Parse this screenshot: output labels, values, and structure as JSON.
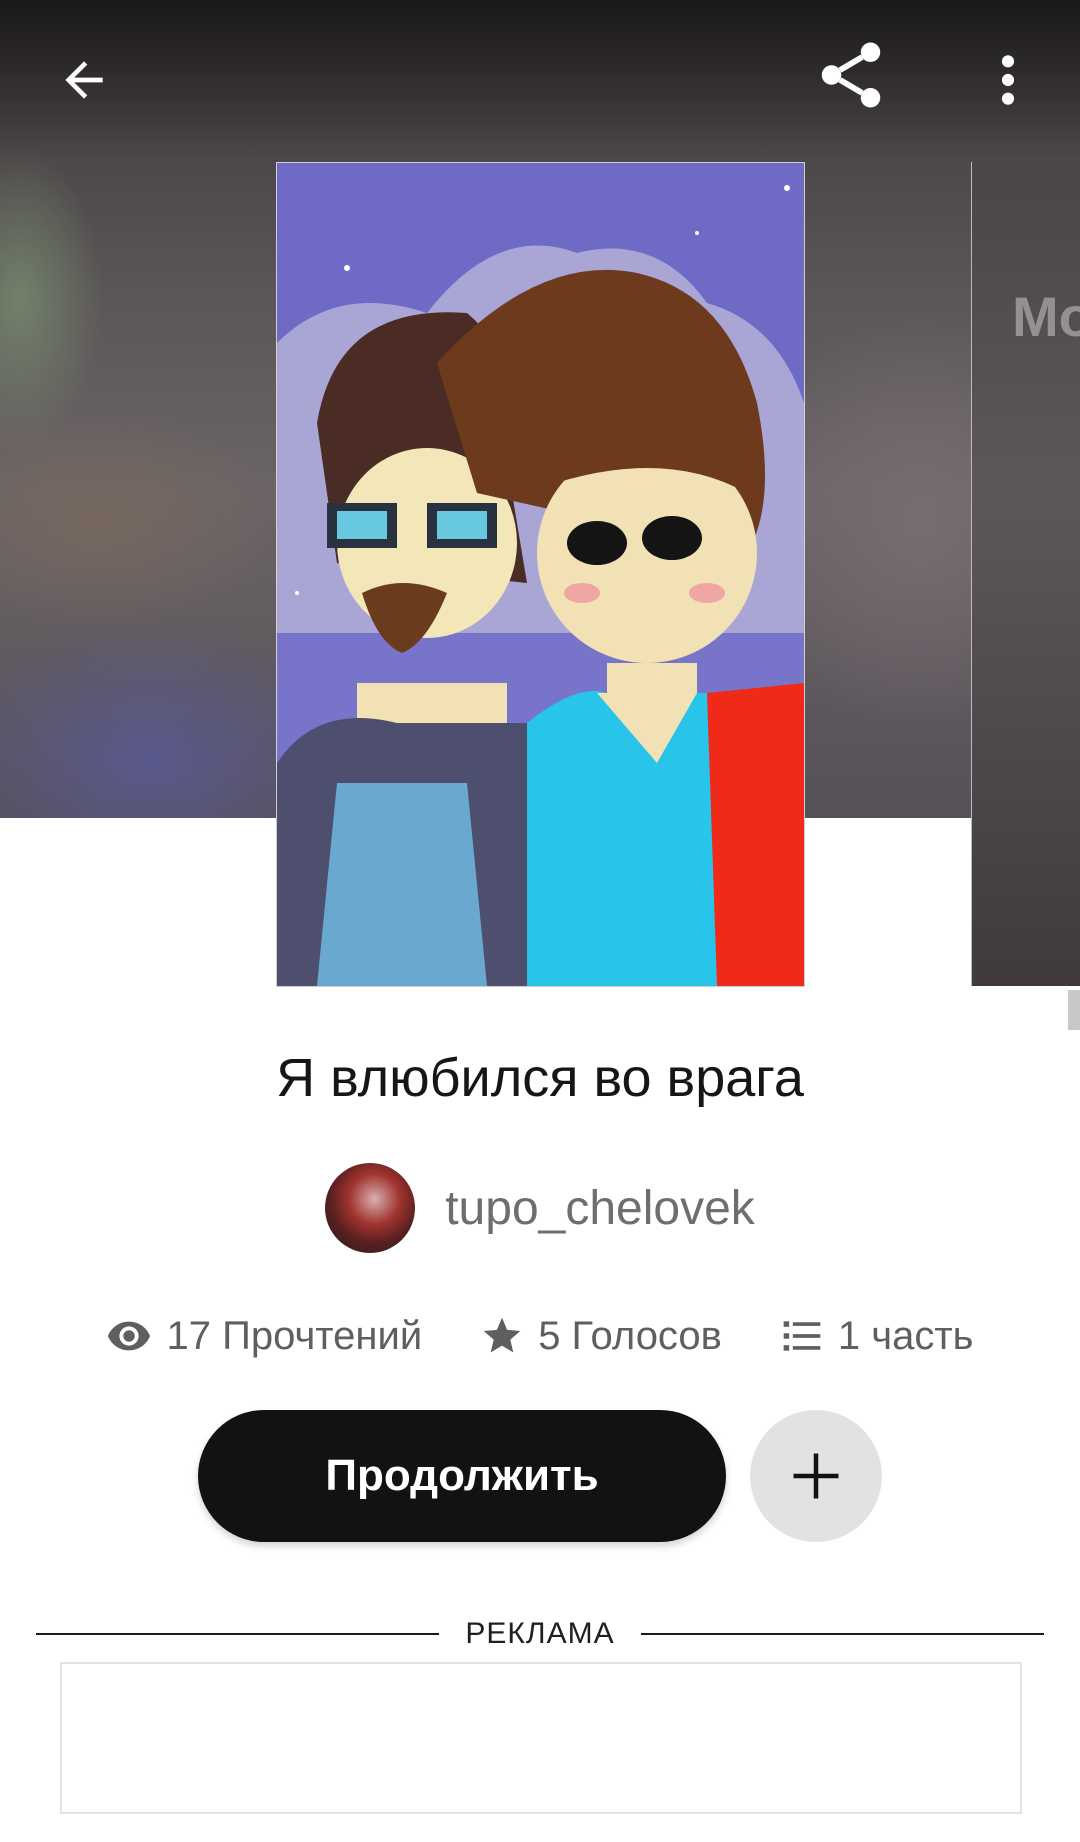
{
  "header": {
    "back_icon": "arrow-left-icon",
    "share_icon": "share-icon",
    "more_icon": "more-vertical-icon"
  },
  "next_cover": {
    "visible_text": "Mo"
  },
  "story": {
    "title": "Я влюбился во врага",
    "author": "tupo_chelovek",
    "stats": {
      "reads": "17 Прочтений",
      "votes": "5 Голосов",
      "parts": "1 часть"
    }
  },
  "actions": {
    "continue_label": "Продолжить",
    "add_icon": "plus-icon"
  },
  "ad": {
    "label": "РЕКЛАМА"
  },
  "colors": {
    "primary_button": "#121212",
    "secondary_button": "#e2e1e4",
    "muted_text": "#5f5f5f"
  }
}
